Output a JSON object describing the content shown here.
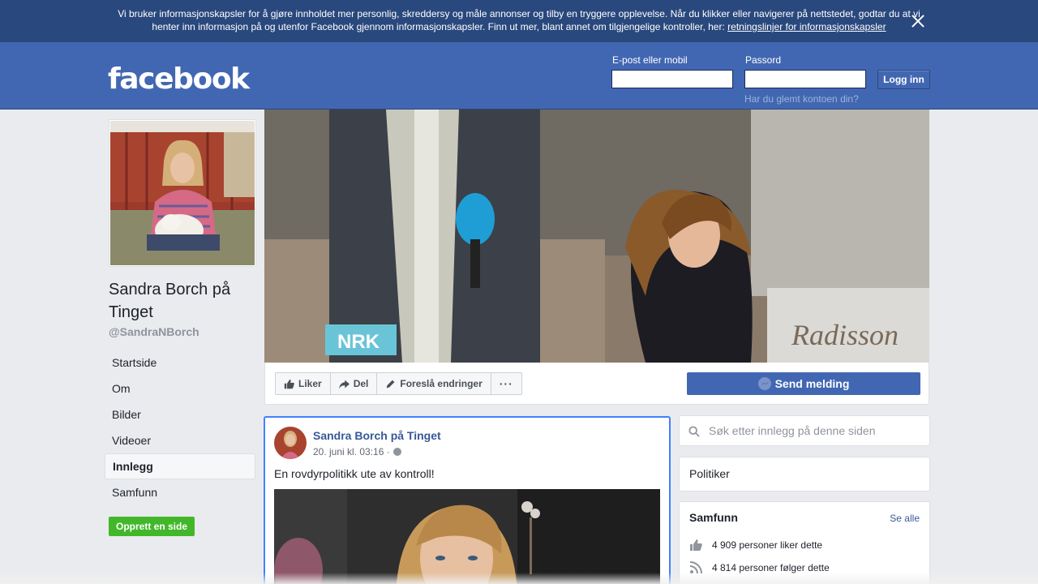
{
  "cookie_banner": {
    "text": "Vi bruker informasjonskapsler for å gjøre innholdet mer personlig, skreddersy og måle annonser og tilby en tryggere opplevelse. Når du klikker eller navigerer på nettstedet, godtar du at vi henter inn informasjon på og utenfor Facebook gjennom informasjonskapsler. Finn ut mer, blant annet om tilgjengelige kontroller, her: ",
    "link": "retningslinjer for informasjonskapsler"
  },
  "header": {
    "logo": "facebook",
    "email_label": "E-post eller mobil",
    "password_label": "Passord",
    "login_button": "Logg inn",
    "forgot_link": "Har du glemt kontoen din?"
  },
  "sidebar": {
    "page_name": "Sandra Borch på Tinget",
    "handle": "@SandraNBorch",
    "items": [
      {
        "label": "Startside"
      },
      {
        "label": "Om"
      },
      {
        "label": "Bilder"
      },
      {
        "label": "Videoer"
      },
      {
        "label": "Innlegg"
      },
      {
        "label": "Samfunn"
      }
    ],
    "create_page": "Opprett en side"
  },
  "cover": {
    "logo_text": "NRK",
    "sign_text": "Radisson"
  },
  "actions": {
    "like": "Liker",
    "share": "Del",
    "suggest": "Foreslå endringer",
    "more": "···",
    "send": "Send melding"
  },
  "post": {
    "author": "Sandra Borch på Tinget",
    "time": "20. juni kl. 03:16 ·",
    "text": "En rovdyrpolitikk ute av kontroll!"
  },
  "right": {
    "search_placeholder": "Søk etter innlegg på denne siden",
    "category": "Politiker",
    "community_title": "Samfunn",
    "see_all": "Se alle",
    "likes_text": "4 909 personer liker dette",
    "follows_text": "4 814 personer følger dette"
  },
  "colors": {
    "header_blue": "#4267b2",
    "banner_blue": "#29487d",
    "link_blue": "#385898",
    "green": "#42b72a"
  }
}
